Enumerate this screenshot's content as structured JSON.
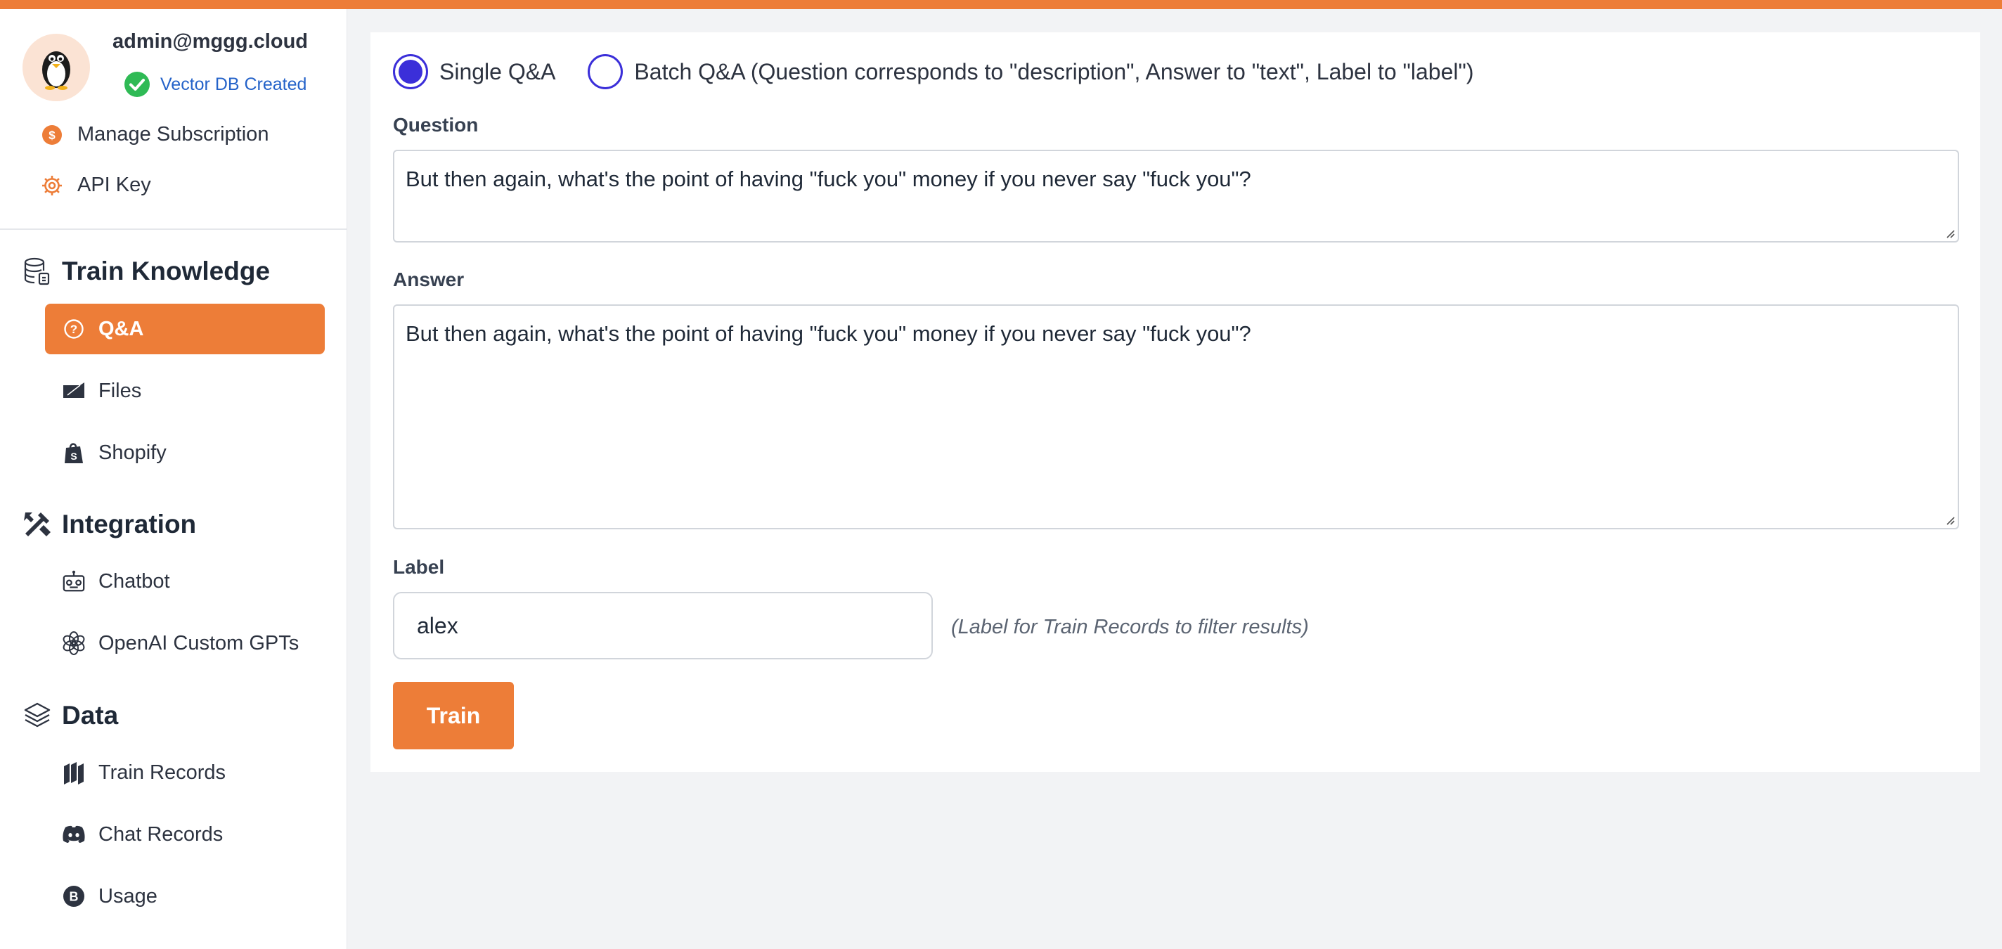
{
  "colors": {
    "accent": "#ed7d38",
    "radio": "#3b2fd9",
    "success": "#2fba55",
    "link": "#2563c9"
  },
  "profile": {
    "email": "admin@mggg.cloud",
    "vector_db_status": "Vector DB Created",
    "manage_subscription": "Manage Subscription",
    "api_key": "API Key"
  },
  "sections": {
    "train_knowledge": "Train Knowledge",
    "integration": "Integration",
    "data": "Data"
  },
  "nav": {
    "qa": "Q&A",
    "files": "Files",
    "shopify": "Shopify",
    "chatbot": "Chatbot",
    "openai_gpts": "OpenAI Custom GPTs",
    "train_records": "Train Records",
    "chat_records": "Chat Records",
    "usage": "Usage"
  },
  "form": {
    "mode_single": "Single Q&A",
    "mode_batch": "Batch Q&A (Question corresponds to \"description\", Answer to \"text\", Label to \"label\")",
    "selected_mode": "single",
    "question_label": "Question",
    "question_value": "But then again, what's the point of having \"fuck you\" money if you never say \"fuck you\"?",
    "answer_label": "Answer",
    "answer_value": "But then again, what's the point of having \"fuck you\" money if you never say \"fuck you\"?",
    "label_label": "Label",
    "label_value": "alex",
    "label_hint": "(Label for Train Records to filter results)",
    "train_button": "Train"
  }
}
